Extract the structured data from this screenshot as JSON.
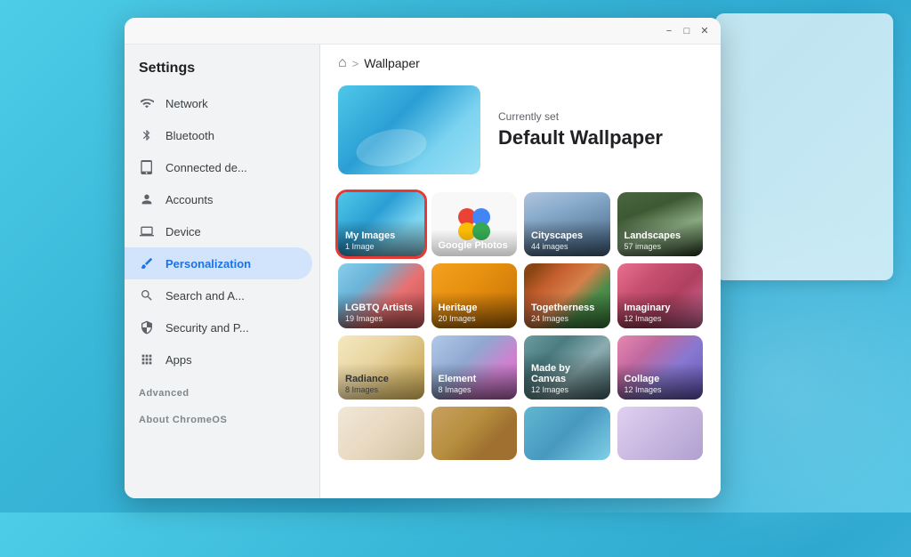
{
  "app": {
    "title": "Settings"
  },
  "titlebar": {
    "minimize": "−",
    "maximize": "□",
    "close": "✕"
  },
  "breadcrumb": {
    "home": "⌂",
    "separator": ">",
    "current": "Wallpaper"
  },
  "current_wallpaper": {
    "label": "Currently set",
    "name": "Default Wallpaper"
  },
  "sidebar": {
    "title": "Settings",
    "items": [
      {
        "id": "network",
        "label": "Network",
        "icon": "wifi"
      },
      {
        "id": "bluetooth",
        "label": "Bluetooth",
        "icon": "bluetooth"
      },
      {
        "id": "connected",
        "label": "Connected de...",
        "icon": "tablet"
      },
      {
        "id": "accounts",
        "label": "Accounts",
        "icon": "person"
      },
      {
        "id": "device",
        "label": "Device",
        "icon": "laptop"
      },
      {
        "id": "personalization",
        "label": "Personalization",
        "icon": "brush",
        "active": true
      },
      {
        "id": "search",
        "label": "Search and A...",
        "icon": "search"
      },
      {
        "id": "security",
        "label": "Security and P...",
        "icon": "shield"
      },
      {
        "id": "apps",
        "label": "Apps",
        "icon": "grid"
      }
    ],
    "advanced": "Advanced",
    "about": "About ChromeOS"
  },
  "grid": {
    "items": [
      {
        "id": "my-images",
        "label": "My Images",
        "sublabel": "1 Image",
        "bg": "myimages",
        "selected": true
      },
      {
        "id": "google-photos",
        "label": "Google Photos",
        "sublabel": "",
        "bg": "googlephotos",
        "selected": false
      },
      {
        "id": "cityscapes",
        "label": "Cityscapes",
        "sublabel": "44 images",
        "bg": "cityscapes",
        "selected": false
      },
      {
        "id": "landscapes",
        "label": "Landscapes",
        "sublabel": "57 images",
        "bg": "landscapes",
        "selected": false
      },
      {
        "id": "lgbtq",
        "label": "LGBTQ Artists",
        "sublabel": "19 Images",
        "bg": "lgbtq",
        "selected": false
      },
      {
        "id": "heritage",
        "label": "Heritage",
        "sublabel": "20 Images",
        "bg": "heritage",
        "selected": false
      },
      {
        "id": "togetherness",
        "label": "Togetherness",
        "sublabel": "24 Images",
        "bg": "togetherness",
        "selected": false
      },
      {
        "id": "imaginary",
        "label": "Imaginary",
        "sublabel": "12 Images",
        "bg": "imaginary",
        "selected": false
      },
      {
        "id": "radiance",
        "label": "Radiance",
        "sublabel": "8 Images",
        "bg": "radiance",
        "selected": false
      },
      {
        "id": "element",
        "label": "Element",
        "sublabel": "8 Images",
        "bg": "element",
        "selected": false
      },
      {
        "id": "madebycanvas",
        "label": "Made by Canvas",
        "sublabel": "12 Images",
        "bg": "madebycanvas",
        "selected": false
      },
      {
        "id": "collage",
        "label": "Collage",
        "sublabel": "12 Images",
        "bg": "collage",
        "selected": false
      },
      {
        "id": "row4a",
        "label": "",
        "sublabel": "",
        "bg": "row4a",
        "selected": false
      },
      {
        "id": "row4b",
        "label": "",
        "sublabel": "",
        "bg": "row4b",
        "selected": false
      },
      {
        "id": "row4c",
        "label": "",
        "sublabel": "",
        "bg": "row4c",
        "selected": false
      },
      {
        "id": "row4d",
        "label": "",
        "sublabel": "",
        "bg": "row4d",
        "selected": false
      }
    ]
  }
}
